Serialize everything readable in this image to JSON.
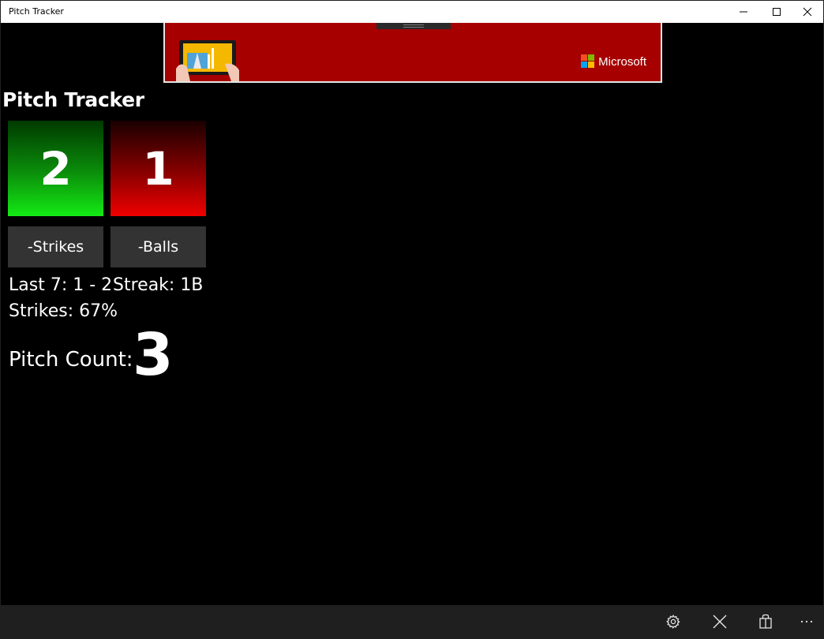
{
  "window": {
    "title": "Pitch Tracker",
    "minimize_icon": "minimize-icon",
    "maximize_icon": "maximize-icon",
    "close_icon": "close-icon"
  },
  "ad": {
    "brand": "Microsoft",
    "brand_colors": [
      "#f25022",
      "#7fba00",
      "#00a4ef",
      "#ffb900"
    ],
    "background": "#a60000"
  },
  "app": {
    "title": "Pitch Tracker"
  },
  "counts": {
    "strikes": "2",
    "balls": "1",
    "strikes_color": "#14ea14",
    "balls_color": "#f00000"
  },
  "buttons": {
    "decrement_strikes": "-Strikes",
    "decrement_balls": "-Balls"
  },
  "stats": {
    "last7": "Last 7: 1 - 2",
    "streak": "Streak: 1B",
    "strike_pct": "Strikes: 67%"
  },
  "pitch_count": {
    "label": "Pitch Count:",
    "value": "3"
  },
  "appbar": {
    "items": [
      "gear-icon",
      "close-icon",
      "store-bag-icon",
      "more-icon"
    ]
  }
}
